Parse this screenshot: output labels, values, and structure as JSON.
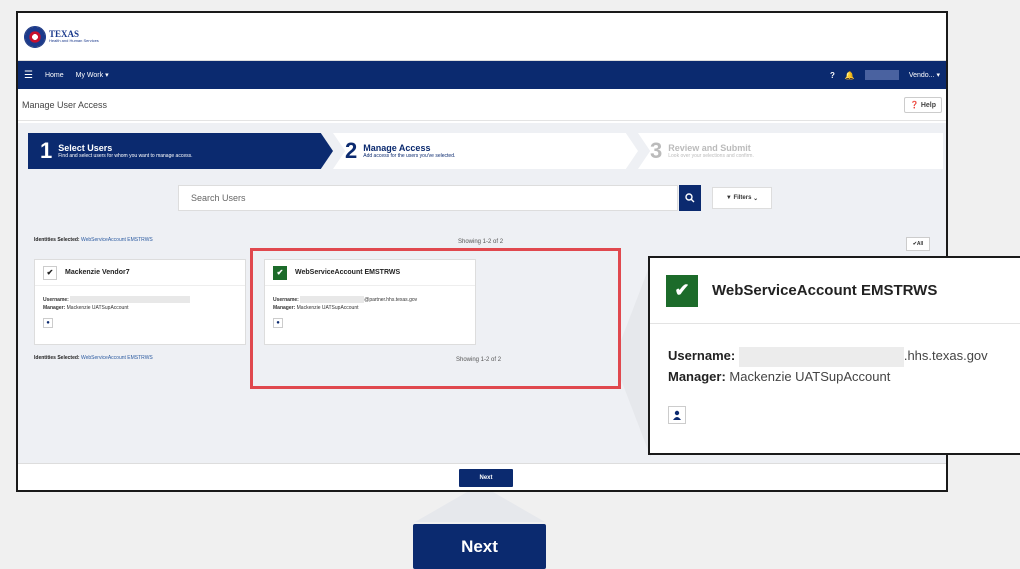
{
  "logo": {
    "line1": "TEXAS",
    "line2": "Health and Human Services"
  },
  "navbar": {
    "home": "Home",
    "my_work": "My Work ▾",
    "help_icon": "❓",
    "bell_icon": "🔔",
    "user": "Vendo... ▾"
  },
  "subheader": {
    "title": "Manage User Access",
    "help_label": "Help"
  },
  "stepper": [
    {
      "num": "1",
      "title": "Select Users",
      "sub": "Find and select users for whom you want to manage access."
    },
    {
      "num": "2",
      "title": "Manage Access",
      "sub": "Add access for the users you've selected."
    },
    {
      "num": "3",
      "title": "Review and Submit",
      "sub": "Look over your selections and confirm."
    }
  ],
  "search": {
    "placeholder": "Search Users",
    "filters_label": "Filters"
  },
  "identities": {
    "label": "Identities Selected:",
    "value": "WebServiceAccount EMSTRWS"
  },
  "showing": "Showing 1-2 of 2",
  "all_label": "All",
  "cards": [
    {
      "name": "Mackenzie Vendor7",
      "username_label": "Username:",
      "username": "",
      "manager_label": "Manager:",
      "manager": "Mackenzie UATSupAccount",
      "checked": false
    },
    {
      "name": "WebServiceAccount EMSTRWS",
      "username_label": "Username:",
      "username": "@partner.hhs.texas.gov",
      "manager_label": "Manager:",
      "manager": "Mackenzie UATSupAccount",
      "checked": true
    }
  ],
  "zoom": {
    "name": "WebServiceAccount EMSTRWS",
    "username_label": "Username:",
    "username": ".hhs.texas.gov",
    "manager_label": "Manager:",
    "manager": "Mackenzie UATSupAccount"
  },
  "next_label": "Next",
  "colors": {
    "primary": "#0b2a6f",
    "check_green": "#1c6b2a",
    "highlight": "#e0484e"
  }
}
